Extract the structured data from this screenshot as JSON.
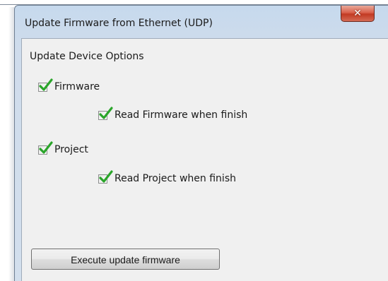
{
  "window": {
    "title": "Update Firmware from Ethernet (UDP)",
    "close_glyph": "✕"
  },
  "options": {
    "section_label": "Update Device Options",
    "firmware": {
      "label": "Firmware",
      "checked": true
    },
    "read_firmware": {
      "label": "Read Firmware when finish",
      "checked": true
    },
    "project": {
      "label": "Project",
      "checked": true
    },
    "read_project": {
      "label": "Read Project when finish",
      "checked": true
    }
  },
  "actions": {
    "execute_label": "Execute update firmware"
  },
  "colors": {
    "checkmark": "#2aa52a",
    "close_button": "#c94a35"
  },
  "icons": {
    "close": "close-icon",
    "check": "checkmark-icon"
  }
}
